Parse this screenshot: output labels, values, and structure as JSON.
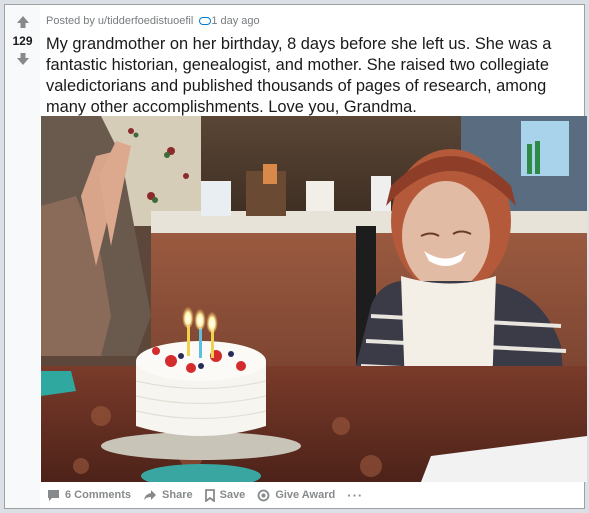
{
  "post": {
    "score": "129",
    "posted_by": "Posted by",
    "username": "u/tidderfoedistuoefil",
    "time": "1 day ago",
    "title": "My grandmother on her birthday, 8 days before she left us. She was a fantastic historian, genealogist, and mother. She raised two collegiate valedictorians and published thousands of pages of research, among many other accomplishments. Love you, Grandma."
  },
  "actions": {
    "comments": "6 Comments",
    "share": "Share",
    "save": "Save",
    "give_award": "Give Award",
    "more": "···"
  },
  "icons": {
    "upvote": "upvote-arrow-icon",
    "downvote": "downvote-arrow-icon",
    "award": "award-pill-icon",
    "comment": "comment-bubble-icon",
    "share": "share-arrow-icon",
    "save": "bookmark-icon",
    "give_award": "award-badge-icon"
  },
  "colors": {
    "meta_text": "#787c7e",
    "action_text": "#878a8c",
    "award_blue": "#0079d3"
  }
}
